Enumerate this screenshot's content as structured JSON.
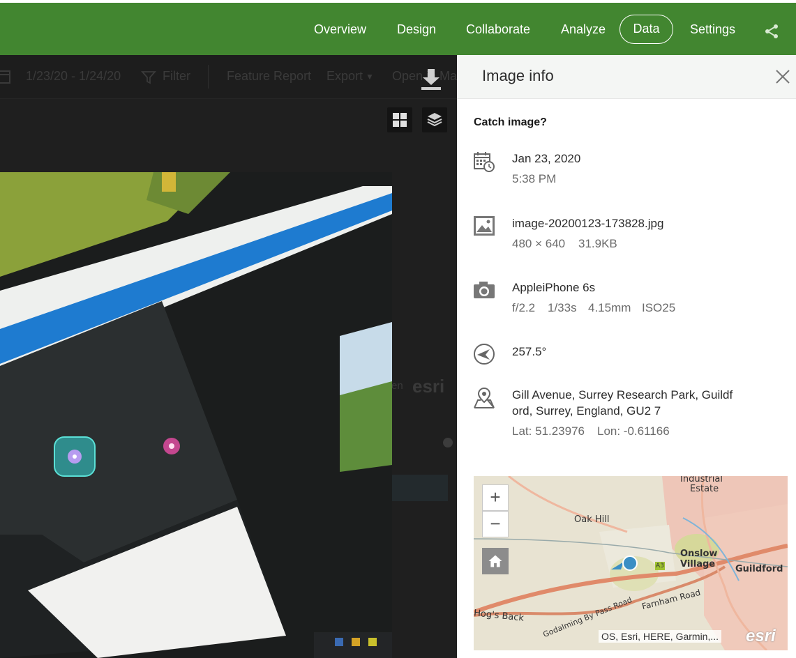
{
  "nav": {
    "items": [
      "Overview",
      "Design",
      "Collaborate",
      "Analyze"
    ],
    "active": "Data",
    "settings": "Settings",
    "share_icon": "share-icon"
  },
  "toolbar": {
    "date_range": "1/23/20 - 1/24/20",
    "filter": "Filter",
    "feature_report": "Feature Report",
    "export": "Export",
    "open_in": "Open in Ma"
  },
  "background": {
    "ghost_text": "en",
    "ghost_logo": "esri"
  },
  "panel": {
    "title": "Image info",
    "question": "Catch image?",
    "date": "Jan 23, 2020",
    "time": "5:38 PM",
    "filename": "image-20200123-173828.jpg",
    "dimensions": "480 × 640",
    "filesize": "31.9KB",
    "device": "AppleiPhone 6s",
    "aperture": "f/2.2",
    "shutter": "1/33s",
    "focal": "4.15mm",
    "iso": "ISO25",
    "heading": "257.5°",
    "address": "Gill Avenue, Surrey Research Park, Guildford, Surrey, England, GU2 7",
    "lat": "Lat: 51.23976",
    "lon": "Lon: -0.61166"
  },
  "map": {
    "zoom_in": "+",
    "zoom_out": "−",
    "attribution": "OS, Esri, HERE, Garmin,...",
    "logo": "esri",
    "labels": {
      "industrial": "Industrial",
      "estate": "Estate",
      "oak_hill": "Oak Hill",
      "onslow": "Onslow",
      "village": "Village",
      "guildford": "Guildford",
      "a3": "A3",
      "hogs_back": "Hog's Back",
      "farnham_road": "Farnham Road",
      "godalming": "Godalming By Pass Road"
    }
  },
  "colors": {
    "brand_green": "#428630",
    "marker_blue": "#3b8fc4"
  }
}
